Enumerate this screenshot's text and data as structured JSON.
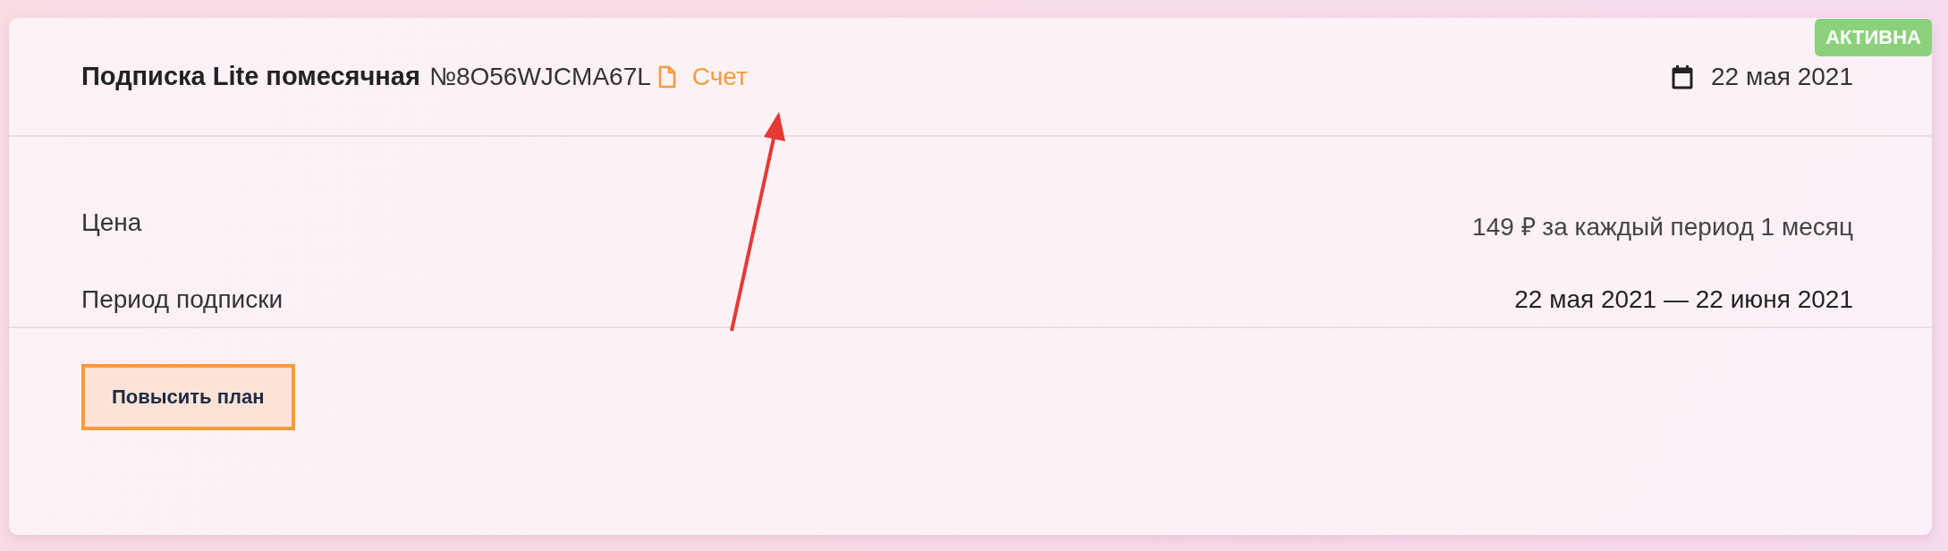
{
  "subscription": {
    "title": "Подписка Lite помесячная",
    "number": "№8O56WJCMA67L",
    "invoice_link": "Счет",
    "date": "22 мая 2021",
    "status": {
      "label": "АКТИВНА",
      "kind": "active"
    }
  },
  "details": [
    {
      "label": "Цена",
      "value": "149 ₽ за каждый период 1 месяц",
      "kind": "light"
    },
    {
      "label": "Период подписки",
      "value": "22 мая 2021 — 22 июня 2021",
      "kind": "strong"
    }
  ],
  "buttons": [
    "Повысить план"
  ],
  "annotation": {
    "kind": "arrow"
  }
}
